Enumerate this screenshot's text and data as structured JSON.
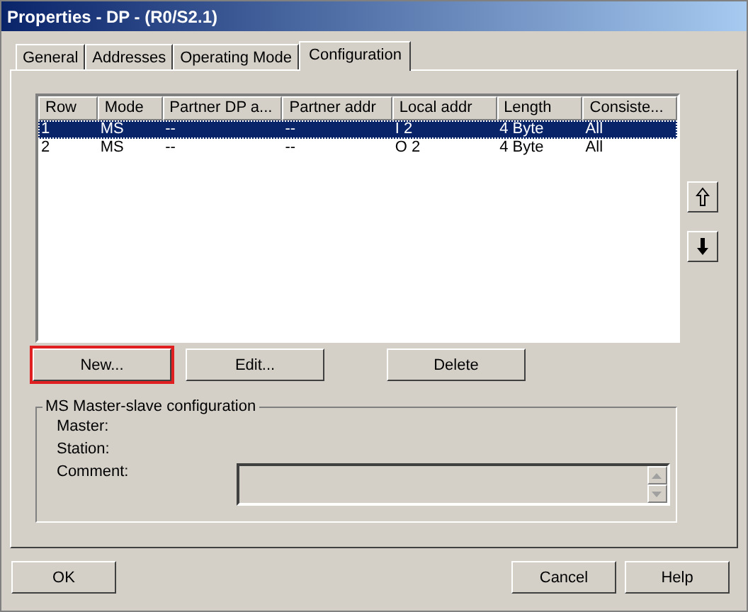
{
  "window": {
    "title": "Properties - DP - (R0/S2.1)"
  },
  "tabs": [
    {
      "label": "General",
      "selected": false
    },
    {
      "label": "Addresses",
      "selected": false
    },
    {
      "label": "Operating Mode",
      "selected": false
    },
    {
      "label": "Configuration",
      "selected": true
    }
  ],
  "table": {
    "columns": [
      "Row",
      "Mode",
      "Partner DP a...",
      "Partner addr",
      "Local addr",
      "Length",
      "Consiste..."
    ],
    "rows": [
      {
        "cells": [
          "1",
          "MS",
          "--",
          "--",
          "I 2",
          "4 Byte",
          "All"
        ],
        "selected": true
      },
      {
        "cells": [
          "2",
          "MS",
          "--",
          "--",
          "O 2",
          "4 Byte",
          "All"
        ],
        "selected": false
      }
    ]
  },
  "move_buttons": [
    {
      "kind": "up"
    },
    {
      "kind": "down"
    }
  ],
  "actions": [
    {
      "label": "New...",
      "highlighted": true
    },
    {
      "label": "Edit...",
      "highlighted": false
    },
    {
      "label": "Delete",
      "highlighted": false
    }
  ],
  "group": {
    "title": "MS Master-slave configuration",
    "labels": [
      "Master:",
      "Station:",
      "Comment:"
    ]
  },
  "buttons": [
    "OK",
    "Cancel",
    "Help"
  ]
}
